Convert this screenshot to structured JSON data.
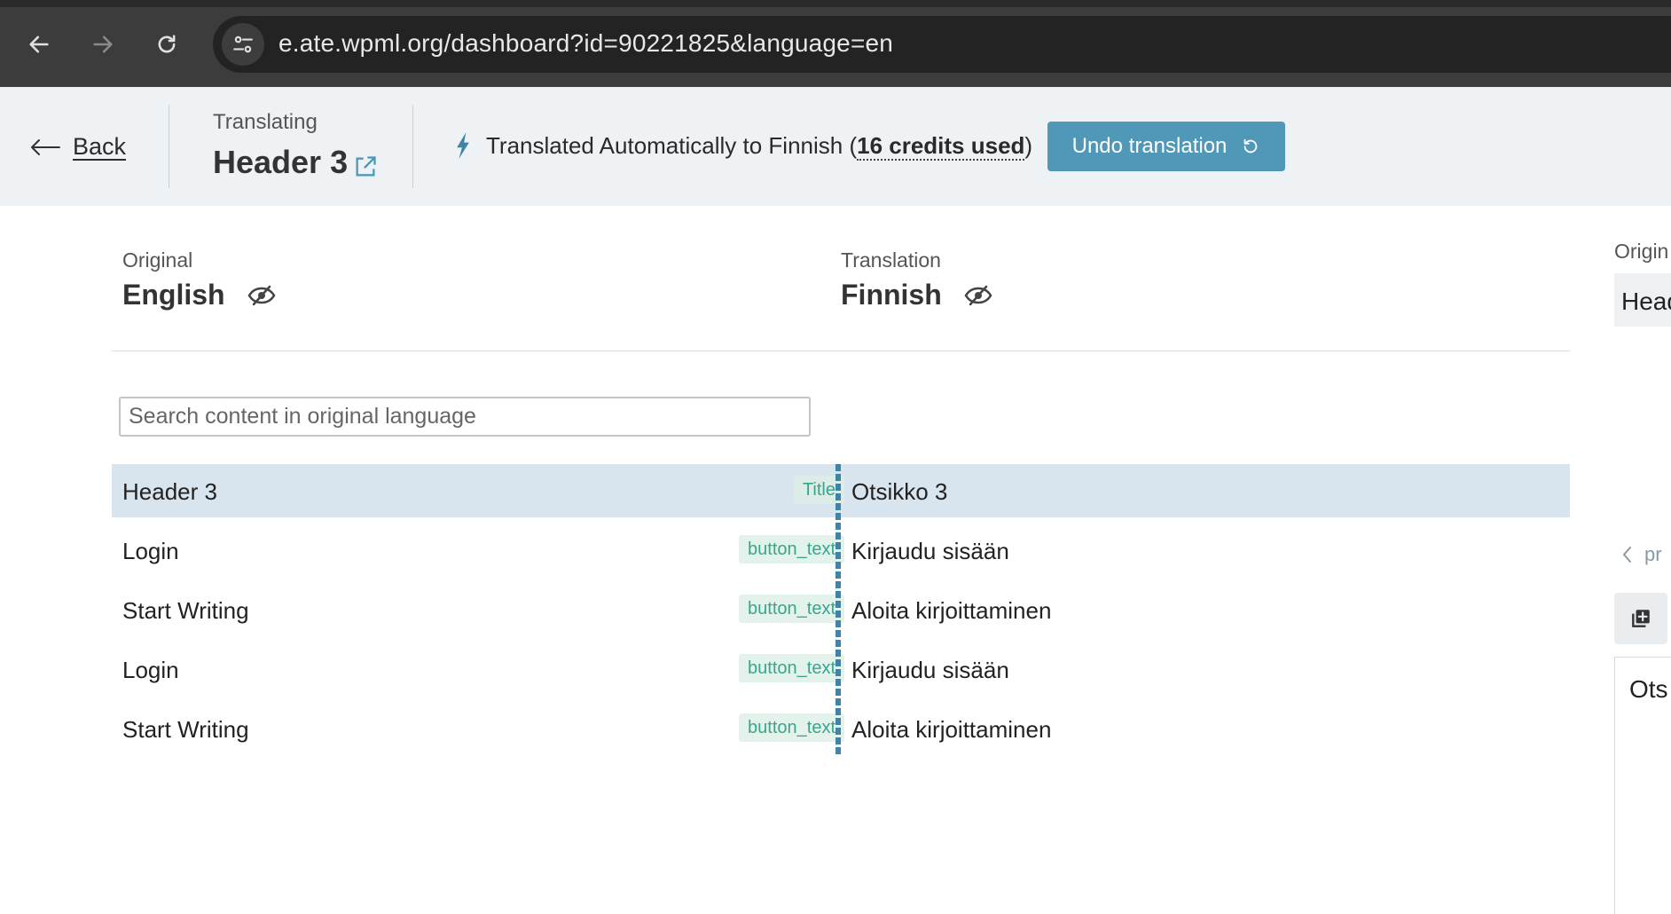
{
  "browser": {
    "url": "e.ate.wpml.org/dashboard?id=90221825&language=en"
  },
  "header": {
    "back_label": "Back",
    "translating_label": "Translating",
    "doc_title": "Header 3",
    "status_prefix": "Translated Automatically to Finnish (",
    "credits": "16 credits used",
    "status_suffix": ")",
    "undo_label": "Undo translation"
  },
  "columns": {
    "original": {
      "label": "Original",
      "language": "English"
    },
    "translation": {
      "label": "Translation",
      "language": "Finnish"
    }
  },
  "search": {
    "placeholder": "Search content in original language"
  },
  "rows": [
    {
      "original": "Header 3",
      "tag": "Title",
      "translation": "Otsikko 3",
      "active": true
    },
    {
      "original": "Login",
      "tag": "button_text",
      "translation": "Kirjaudu sisään",
      "active": false
    },
    {
      "original": "Start Writing",
      "tag": "button_text",
      "translation": "Aloita kirjoittaminen",
      "active": false
    },
    {
      "original": "Login",
      "tag": "button_text",
      "translation": "Kirjaudu sisään",
      "active": false
    },
    {
      "original": "Start Writing",
      "tag": "button_text",
      "translation": "Aloita kirjoittaminen",
      "active": false
    }
  ],
  "right_panel": {
    "label": "Origin",
    "field": "Head",
    "prev": "pr",
    "area_text": "Ots"
  },
  "colors": {
    "accent": "#4f98b8",
    "tag_text": "#3aa58a",
    "active_row": "#d9e5ee"
  }
}
